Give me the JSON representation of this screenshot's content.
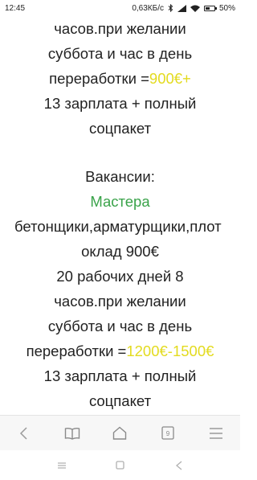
{
  "status_bar": {
    "time": "12:45",
    "speed": "0,63КБ/с",
    "battery": "50%",
    "battery_level": 0.5
  },
  "message": {
    "block1": {
      "line1": "часов.при желании",
      "line2": "суббота и час в день",
      "line3_prefix": "переработки =",
      "line3_highlight": "900€+",
      "line4": "13 зарплата + полный",
      "line5": "соцпакет"
    },
    "vacancies_heading": "Вакансии:",
    "role": "Мастера",
    "trades": "бетонщики,арматурщики,плот",
    "salary": "оклад 900€",
    "block2": {
      "line1": "20 рабочих дней 8",
      "line2": "часов.при желании",
      "line3": "суббота и час в день",
      "line4_prefix": "переработки =",
      "line4_highlight": "1200€-1500€",
      "line5": "13 зарплата + полный",
      "line6": "соцпакет"
    },
    "highlight_color": "#e3db1f",
    "role_color": "#3aa34a"
  },
  "browser_toolbar": {
    "items": [
      "back-icon",
      "bookmarks-icon",
      "home-icon",
      "tabs-icon",
      "menu-icon"
    ],
    "tabs_count": "9"
  },
  "system_nav": {
    "items": [
      "recents-icon",
      "home-square-icon",
      "back-triangle-icon"
    ]
  }
}
